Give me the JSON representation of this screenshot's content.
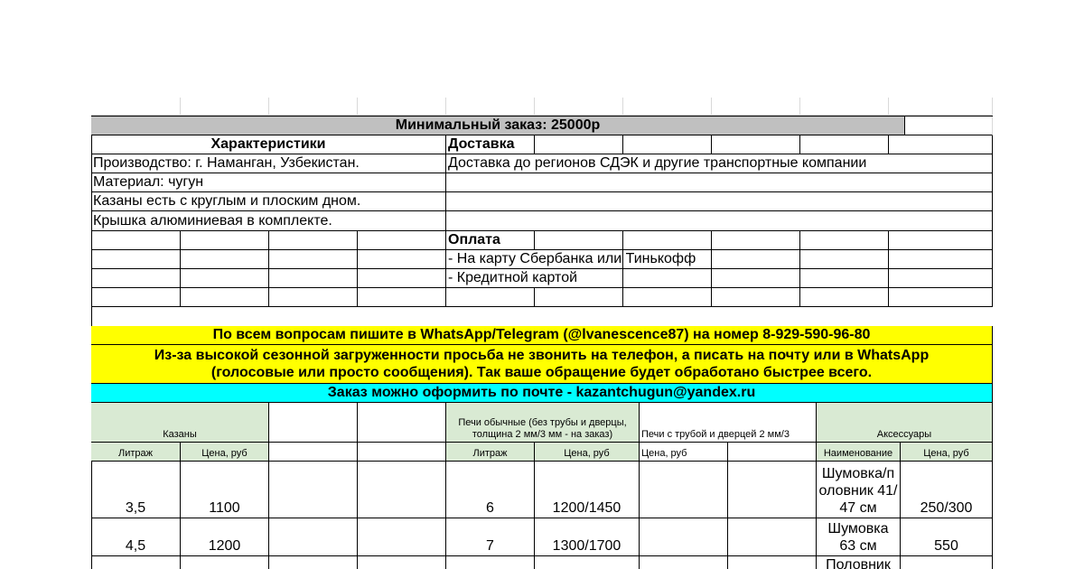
{
  "min_order": "Минимальный заказ: 25000р",
  "characteristics": {
    "header": "Характеристики",
    "lines": [
      "Производство: г. Наманган, Узбекистан.",
      "Материал: чугун",
      "Казаны есть с круглым и плоским дном.",
      "Крышка алюминиевая в комплекте."
    ]
  },
  "delivery": {
    "header": "Доставка",
    "text": "Доставка до регионов СДЭК и другие транспортные компании"
  },
  "payment": {
    "header": "Оплата",
    "lines": [
      "- На карту Сбербанка или Тинькофф",
      "- Кредитной картой"
    ]
  },
  "notices": {
    "whatsapp": "По всем вопросам пишите в WhatsApp/Telegram (@lvanescence87) на номер 8-929-590-96-80",
    "load_line1": "Из-за высокой сезонной загруженности просьба не звонить на телефон, а писать на почту или в WhatsApp",
    "load_line2": "(голосовые или просто сообщения). Так ваше обращение будет обработано быстрее всего.",
    "email": "Заказ можно оформить по почте - kazantchugun@yandex.ru"
  },
  "sections": {
    "kazany": "Казаны",
    "stoves_plain": "Печи обычные (без трубы и дверцы, толщина 2 мм/3 мм - на заказ)",
    "stoves_pipe": "Печи с трубой и дверцей 2 мм/3",
    "accessories": "Аксессуары"
  },
  "subheaders": {
    "kazany_volume": "Литраж",
    "kazany_price": "Цена, руб",
    "stoves_volume": "Литраж",
    "stoves_price": "Цена, руб",
    "pipe_price": "Цена, руб",
    "acc_name": "Наименование",
    "acc_price": "Цена, руб"
  },
  "rows": [
    {
      "kazan_volume": "3,5",
      "kazan_price": "1100",
      "stove_volume": "6",
      "stove_price": "1200/1450",
      "acc_name": "Шумовка/половник 41/47 см",
      "acc_price": "250/300"
    },
    {
      "kazan_volume": "4,5",
      "kazan_price": "1200",
      "stove_volume": "7",
      "stove_price": "1300/1700",
      "acc_name": "Шумовка 63 см",
      "acc_price": "550"
    },
    {
      "kazan_volume": "",
      "kazan_price": "",
      "stove_volume": "",
      "stove_price": "",
      "acc_name": "Половник",
      "acc_price": ""
    }
  ]
}
